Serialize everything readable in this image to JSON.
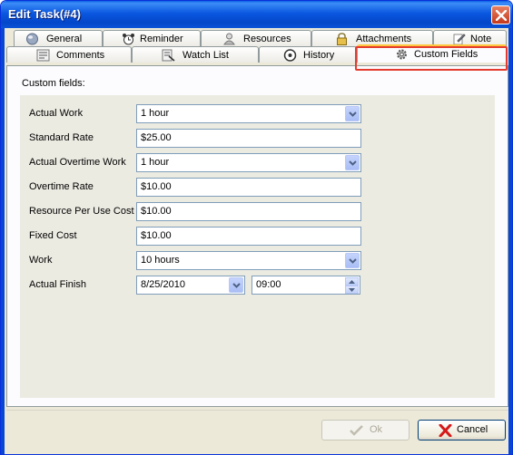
{
  "window": {
    "title": "Edit Task(#4)"
  },
  "tabs": {
    "row1": [
      {
        "id": "general",
        "label": "General",
        "icon": "globe-icon"
      },
      {
        "id": "reminder",
        "label": "Reminder",
        "icon": "alarm-clock-icon"
      },
      {
        "id": "resources",
        "label": "Resources",
        "icon": "person-icon"
      },
      {
        "id": "attachments",
        "label": "Attachments",
        "icon": "padlock-icon"
      },
      {
        "id": "note",
        "label": "Note",
        "icon": "note-icon"
      }
    ],
    "row2": [
      {
        "id": "comments",
        "label": "Comments",
        "icon": "comments-icon"
      },
      {
        "id": "watch-list",
        "label": "Watch List",
        "icon": "watch-list-icon"
      },
      {
        "id": "history",
        "label": "History",
        "icon": "history-icon"
      },
      {
        "id": "custom-fields",
        "label": "Custom Fields",
        "icon": "gear-icon",
        "active": true
      }
    ]
  },
  "panel": {
    "heading": "Custom fields:"
  },
  "fields": [
    {
      "label": "Actual Work",
      "value": "1 hour",
      "kind": "select"
    },
    {
      "label": "Standard Rate",
      "value": "$25.00",
      "kind": "text"
    },
    {
      "label": "Actual Overtime Work",
      "value": "1 hour",
      "kind": "select"
    },
    {
      "label": "Overtime Rate",
      "value": "$10.00",
      "kind": "text"
    },
    {
      "label": "Resource Per Use Cost",
      "value": "$10.00",
      "kind": "text"
    },
    {
      "label": "Fixed Cost",
      "value": "$10.00",
      "kind": "text"
    },
    {
      "label": "Work",
      "value": "10 hours",
      "kind": "select"
    },
    {
      "label": "Actual Finish",
      "date": "8/25/2010",
      "time": "09:00",
      "kind": "datetime"
    }
  ],
  "buttons": {
    "ok": {
      "label": "Ok",
      "enabled": false,
      "icon": "checkmark-icon"
    },
    "cancel": {
      "label": "Cancel",
      "enabled": true,
      "icon": "red-x-icon"
    }
  },
  "colors": {
    "title_bar": "#0b58e0",
    "dialog_background": "#ece9d8",
    "highlight_outline": "#e53b2e",
    "active_tab_accent": "#ffc83c"
  }
}
